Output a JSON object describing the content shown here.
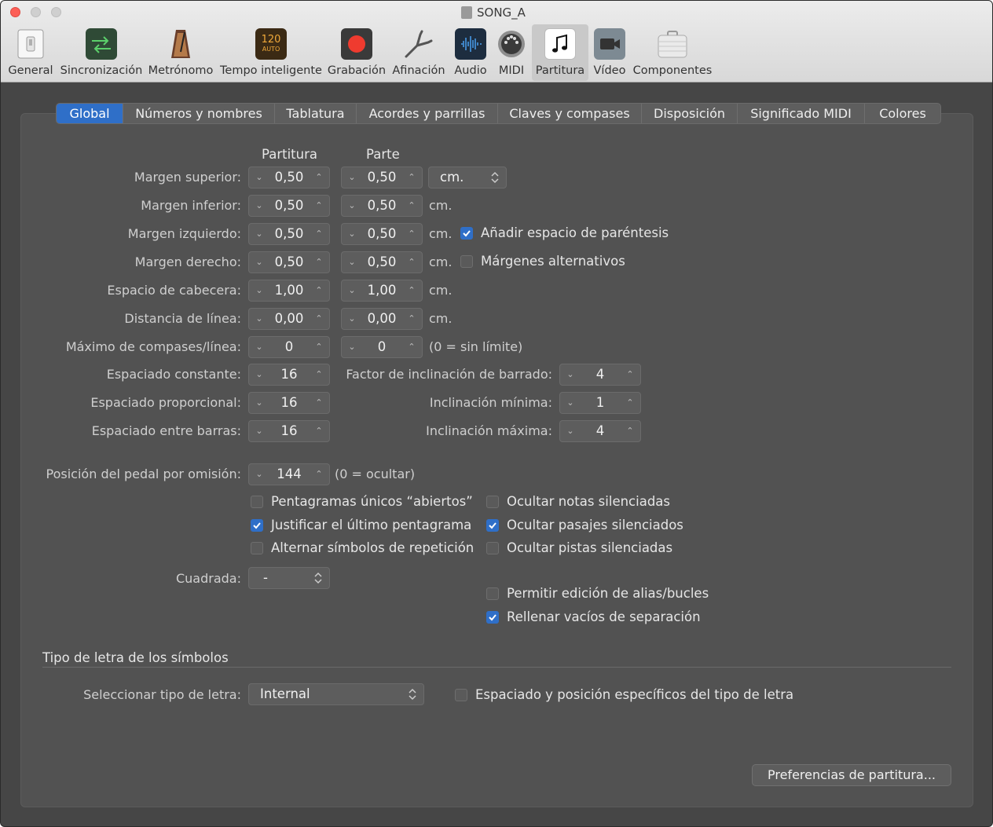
{
  "window": {
    "title": "SONG_A"
  },
  "toolbar": [
    {
      "label": "General",
      "icon": "switch-icon"
    },
    {
      "label": "Sincronización",
      "icon": "sync-icon"
    },
    {
      "label": "Metrónomo",
      "icon": "metronome-icon"
    },
    {
      "label": "Tempo inteligente",
      "icon": "smart-tempo-icon",
      "badge_top": "120",
      "badge_bottom": "AUTO"
    },
    {
      "label": "Grabación",
      "icon": "record-icon"
    },
    {
      "label": "Afinación",
      "icon": "tuning-fork-icon"
    },
    {
      "label": "Audio",
      "icon": "audio-waveform-icon"
    },
    {
      "label": "MIDI",
      "icon": "midi-port-icon"
    },
    {
      "label": "Partitura",
      "icon": "score-note-icon",
      "selected": true
    },
    {
      "label": "Vídeo",
      "icon": "video-camera-icon"
    },
    {
      "label": "Componentes",
      "icon": "briefcase-icon"
    }
  ],
  "tabs": [
    "Global",
    "Números y nombres",
    "Tablatura",
    "Acordes y parrillas",
    "Claves y compases",
    "Disposición",
    "Significado MIDI",
    "Colores"
  ],
  "selected_tab": "Global",
  "columns": {
    "partitura": "Partitura",
    "parte": "Parte"
  },
  "rows": [
    {
      "label": "Margen superior:",
      "partitura": "0,50",
      "parte": "0,50"
    },
    {
      "label": "Margen inferior:",
      "partitura": "0,50",
      "parte": "0,50",
      "unit": "cm."
    },
    {
      "label": "Margen izquierdo:",
      "partitura": "0,50",
      "parte": "0,50",
      "unit": "cm."
    },
    {
      "label": "Margen derecho:",
      "partitura": "0,50",
      "parte": "0,50",
      "unit": "cm."
    },
    {
      "label": "Espacio de cabecera:",
      "partitura": "1,00",
      "parte": "1,00",
      "unit": "cm."
    },
    {
      "label": "Distancia de línea:",
      "partitura": "0,00",
      "parte": "0,00",
      "unit": "cm."
    },
    {
      "label": "Máximo de compases/línea:",
      "partitura": "0",
      "parte": "0",
      "unit": "(0 = sin límite)"
    }
  ],
  "unit_popup": "cm.",
  "margin_checks": [
    {
      "label": "Añadir espacio de paréntesis",
      "checked": true
    },
    {
      "label": "Márgenes alternativos",
      "checked": false
    }
  ],
  "spacing": [
    {
      "label": "Espaciado constante:",
      "value": "16"
    },
    {
      "label": "Espaciado proporcional:",
      "value": "16"
    },
    {
      "label": "Espaciado entre barras:",
      "value": "16"
    }
  ],
  "beam": [
    {
      "label": "Factor de inclinación de barrado:",
      "value": "4"
    },
    {
      "label": "Inclinación mínima:",
      "value": "1"
    },
    {
      "label": "Inclinación máxima:",
      "value": "4"
    }
  ],
  "pedal": {
    "label": "Posición del pedal por omisión:",
    "value": "144",
    "hint": "(0 = ocultar)"
  },
  "left_checks": [
    {
      "label": "Pentagramas únicos “abiertos”",
      "checked": false
    },
    {
      "label": "Justificar el último pentagrama",
      "checked": true
    },
    {
      "label": "Alternar símbolos de repetición",
      "checked": false
    }
  ],
  "right_checks": [
    {
      "label": "Ocultar notas silenciadas",
      "checked": false
    },
    {
      "label": "Ocultar pasajes silenciados",
      "checked": true
    },
    {
      "label": "Ocultar pistas silenciadas",
      "checked": false
    }
  ],
  "right_checks2": [
    {
      "label": "Permitir edición de alias/bucles",
      "checked": false
    },
    {
      "label": "Rellenar vacíos de separación",
      "checked": true
    }
  ],
  "cuadrada": {
    "label": "Cuadrada:",
    "value": "-"
  },
  "font_section": {
    "title": "Tipo de letra de los símbolos",
    "label": "Seleccionar tipo de letra:",
    "value": "Internal",
    "check_label": "Espaciado y posición específicos del tipo de letra",
    "checked": false
  },
  "pref_button": "Preferencias de partitura...",
  "colors": {
    "accent": "#2f6fc8",
    "window_bg": "#464646",
    "panel_bg": "#525252"
  }
}
